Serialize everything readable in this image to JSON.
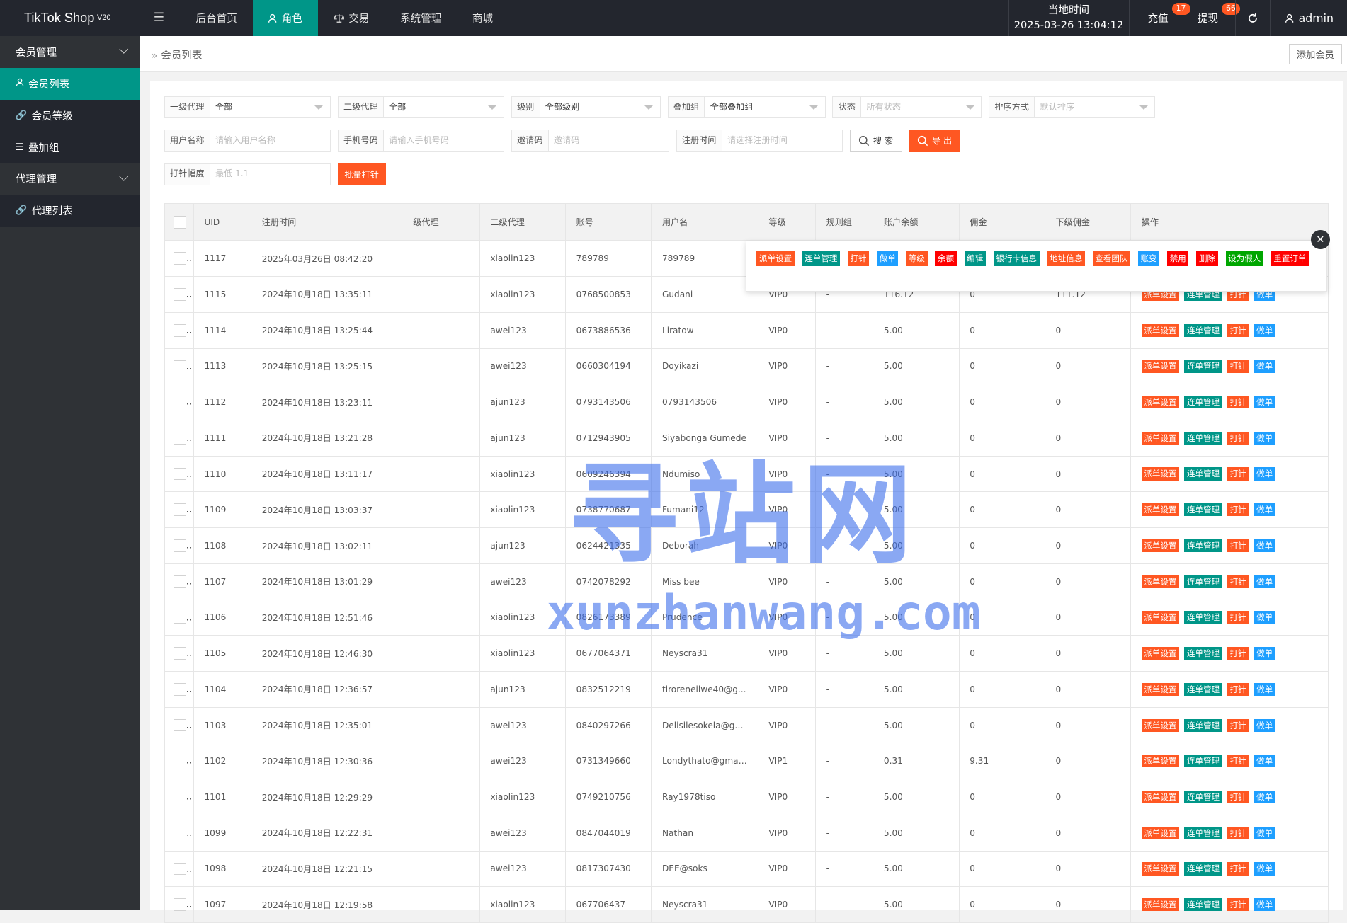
{
  "app": {
    "logo": "TikTok Shop",
    "version": "V20"
  },
  "topnav": {
    "menu_icon": "menu-icon",
    "items": [
      {
        "label": "后台首页",
        "icon": ""
      },
      {
        "label": "角色",
        "icon": "user-icon",
        "active": true
      },
      {
        "label": "交易",
        "icon": "scale-icon"
      },
      {
        "label": "系统管理",
        "icon": ""
      },
      {
        "label": "商城",
        "icon": ""
      }
    ],
    "time_label": "当地时间",
    "time_value": "2025-03-26 13:04:12",
    "recharge": "充值",
    "recharge_count": "17",
    "withdraw": "提现",
    "withdraw_count": "66",
    "user": "admin"
  },
  "sidebar": {
    "groups": [
      {
        "label": "会员管理",
        "items": [
          "会员列表",
          "会员等级",
          "叠加组"
        ]
      },
      {
        "label": "代理管理",
        "items": [
          "代理列表"
        ]
      }
    ]
  },
  "breadcrumb": {
    "current": "会员列表"
  },
  "add_button": "添加会员",
  "filters": {
    "agent1": {
      "label": "一级代理",
      "value": "全部"
    },
    "agent2": {
      "label": "二级代理",
      "value": "全部"
    },
    "level": {
      "label": "级别",
      "value": "全部级别"
    },
    "stack": {
      "label": "叠加组",
      "value": "全部叠加组"
    },
    "status": {
      "label": "状态",
      "placeholder": "所有状态"
    },
    "sort": {
      "label": "排序方式",
      "placeholder": "默认排序"
    },
    "username": {
      "label": "用户名称",
      "placeholder": "请输入用户名称"
    },
    "phone": {
      "label": "手机号码",
      "placeholder": "请输入手机号码"
    },
    "invite": {
      "label": "邀请码",
      "placeholder": "邀请码"
    },
    "regtime": {
      "label": "注册时间",
      "placeholder": "请选择注册时间"
    },
    "search_btn": "搜 索",
    "export_btn": "导 出",
    "needle": {
      "label": "打针幅度",
      "placeholder": "最低 1.1"
    },
    "batch_btn": "批量打针"
  },
  "table": {
    "headers": [
      "UID",
      "注册时间",
      "一级代理",
      "二级代理",
      "账号",
      "用户名",
      "等级",
      "规则组",
      "账户余额",
      "佣金",
      "下级佣金",
      "操作"
    ],
    "actions": [
      "派单设置",
      "连单管理",
      "打针",
      "做单"
    ],
    "rows": [
      [
        "1117",
        "2025年03月26日 08:42:20",
        "",
        "xiaolin123",
        "789789",
        "789789",
        "",
        "",
        "",
        "",
        ""
      ],
      [
        "1115",
        "2024年10月18日 13:35:11",
        "",
        "xiaolin123",
        "0768500853",
        "Gudani",
        "VIP0",
        "-",
        "116.12",
        "0",
        "111.12"
      ],
      [
        "1114",
        "2024年10月18日 13:25:44",
        "",
        "awei123",
        "0673886536",
        "Liratow",
        "VIP0",
        "-",
        "5.00",
        "0",
        "0"
      ],
      [
        "1113",
        "2024年10月18日 13:25:15",
        "",
        "awei123",
        "0660304194",
        "Doyikazi",
        "VIP0",
        "-",
        "5.00",
        "0",
        "0"
      ],
      [
        "1112",
        "2024年10月18日 13:23:11",
        "",
        "ajun123",
        "0793143506",
        "0793143506",
        "VIP0",
        "-",
        "5.00",
        "0",
        "0"
      ],
      [
        "1111",
        "2024年10月18日 13:21:28",
        "",
        "ajun123",
        "0712943905",
        "Siyabonga Gumede",
        "VIP0",
        "-",
        "5.00",
        "0",
        "0"
      ],
      [
        "1110",
        "2024年10月18日 13:11:17",
        "",
        "xiaolin123",
        "0609246394",
        "Ndumiso",
        "VIP0",
        "-",
        "5.00",
        "0",
        "0"
      ],
      [
        "1109",
        "2024年10月18日 13:03:37",
        "",
        "xiaolin123",
        "0738770687",
        "Fumani12",
        "VIP0",
        "-",
        "5.00",
        "0",
        "0"
      ],
      [
        "1108",
        "2024年10月18日 13:02:11",
        "",
        "ajun123",
        "0624421335",
        "Deborah",
        "VIP0",
        "-",
        "5.00",
        "0",
        "0"
      ],
      [
        "1107",
        "2024年10月18日 13:01:29",
        "",
        "awei123",
        "0742078292",
        "Miss bee",
        "VIP0",
        "-",
        "5.00",
        "0",
        "0"
      ],
      [
        "1106",
        "2024年10月18日 12:51:46",
        "",
        "xiaolin123",
        "0826173389",
        "Prudence",
        "VIP0",
        "-",
        "5.00",
        "0",
        "0"
      ],
      [
        "1105",
        "2024年10月18日 12:46:30",
        "",
        "xiaolin123",
        "0677064371",
        "Neyscra31",
        "VIP0",
        "-",
        "5.00",
        "0",
        "0"
      ],
      [
        "1104",
        "2024年10月18日 12:36:57",
        "",
        "ajun123",
        "0832512219",
        "tiroreneilwe40@g...",
        "VIP0",
        "-",
        "5.00",
        "0",
        "0"
      ],
      [
        "1103",
        "2024年10月18日 12:35:01",
        "",
        "awei123",
        "0840297266",
        "Delisilesokela@gm...",
        "VIP0",
        "-",
        "5.00",
        "0",
        "0"
      ],
      [
        "1102",
        "2024年10月18日 12:30:36",
        "",
        "awei123",
        "0731349660",
        "Londythato@gmail...",
        "VIP1",
        "-",
        "0.31",
        "9.31",
        "0"
      ],
      [
        "1101",
        "2024年10月18日 12:29:29",
        "",
        "xiaolin123",
        "0749210756",
        "Ray1978tiso",
        "VIP0",
        "-",
        "5.00",
        "0",
        "0"
      ],
      [
        "1099",
        "2024年10月18日 12:22:31",
        "",
        "awei123",
        "0847044019",
        "Nathan",
        "VIP0",
        "-",
        "5.00",
        "0",
        "0"
      ],
      [
        "1098",
        "2024年10月18日 12:21:15",
        "",
        "awei123",
        "0817307430",
        "DEE@soks",
        "VIP0",
        "-",
        "5.00",
        "0",
        "0"
      ],
      [
        "1097",
        "2024年10月18日 12:19:58",
        "",
        "xiaolin123",
        "067706437",
        "Neyscra31",
        "VIP0",
        "-",
        "5.00",
        "0",
        "0"
      ]
    ]
  },
  "popup": {
    "close_icon": "close-icon",
    "tags": [
      {
        "label": "派单设置",
        "color": "#ff5722"
      },
      {
        "label": "连单管理",
        "color": "#009688"
      },
      {
        "label": "打针",
        "color": "#ff5722"
      },
      {
        "label": "做单",
        "color": "#1e9fff"
      },
      {
        "label": "等级",
        "color": "#ff5722"
      },
      {
        "label": "余额",
        "color": "#ff0000"
      },
      {
        "label": "编辑",
        "color": "#009688"
      },
      {
        "label": "银行卡信息",
        "color": "#009688"
      },
      {
        "label": "地址信息",
        "color": "#ff5722"
      },
      {
        "label": "查看团队",
        "color": "#ff5722"
      },
      {
        "label": "账变",
        "color": "#1e9fff"
      },
      {
        "label": "禁用",
        "color": "#ff0000"
      },
      {
        "label": "删除",
        "color": "#ff0000"
      },
      {
        "label": "设为假人",
        "color": "#00a600"
      },
      {
        "label": "重置订单",
        "color": "#ff0000"
      }
    ]
  },
  "watermark": {
    "cn": "寻站网",
    "en": "xunzhanwang.com"
  },
  "colors": {
    "accent": "#009688",
    "danger": "#ff5722",
    "topbar": "#23262e",
    "sidebar": "#2f3236"
  }
}
